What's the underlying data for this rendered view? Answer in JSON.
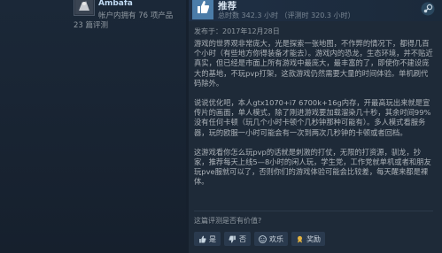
{
  "author": {
    "name": "Ambafa",
    "owned_games": "帐户内拥有 76 项产品",
    "reviews": "23 篇评测"
  },
  "review": {
    "recommendation": "推荐",
    "hours": "总时数 342.3 小时 （评测时 320.3 小时）",
    "posted": "发布于：2017年12月28日",
    "paragraphs": [
      "游戏的世界观非常庞大，光是探索一张地图，不作弊的情况下，都得几百个小时（有些地方你得装备才能去）。游戏内的恐龙，生态环境，并不贴近真实，但已经是市面上所有游戏中最庞大，最丰富的了，即使你不建设庞大的基地，不玩pvp打架，这款游戏仍然需要大量的时间体验。单机刷代码除外。",
      "说说优化吧，本人gtx1070+i7 6700k+16g内存，开最高玩出来就是宣传片的画面，单人模式，除了刚进游戏要加载溜染几十秒，其余时间99%没有任何卡顿（玩几个小时卡顿个几秒钟那种可能有）。多人模式看服务器，玩的欧服一小时可能会有一次到两次几秒钟的卡顿或者回档。",
      "这游戏看你怎么玩pvp的话就是刺激的打仗，无限的打资源，驯龙，抄家，推荐每天上线5—8小时的闲人玩，学生党，工作党就单机或者和朋友玩pve服就可以了，否则你们的游戏体验可能会比较差，每天醒来都是裸体。"
    ],
    "helpful_question": "这篇评测是否有价值?",
    "buttons": {
      "yes": "是",
      "no": "否",
      "funny": "欢乐",
      "award": "奖励"
    }
  },
  "colors": {
    "background": "#16202d",
    "panel": "#1e2a38",
    "thumb": "#4b7ca8",
    "text": "#acb2b8"
  }
}
